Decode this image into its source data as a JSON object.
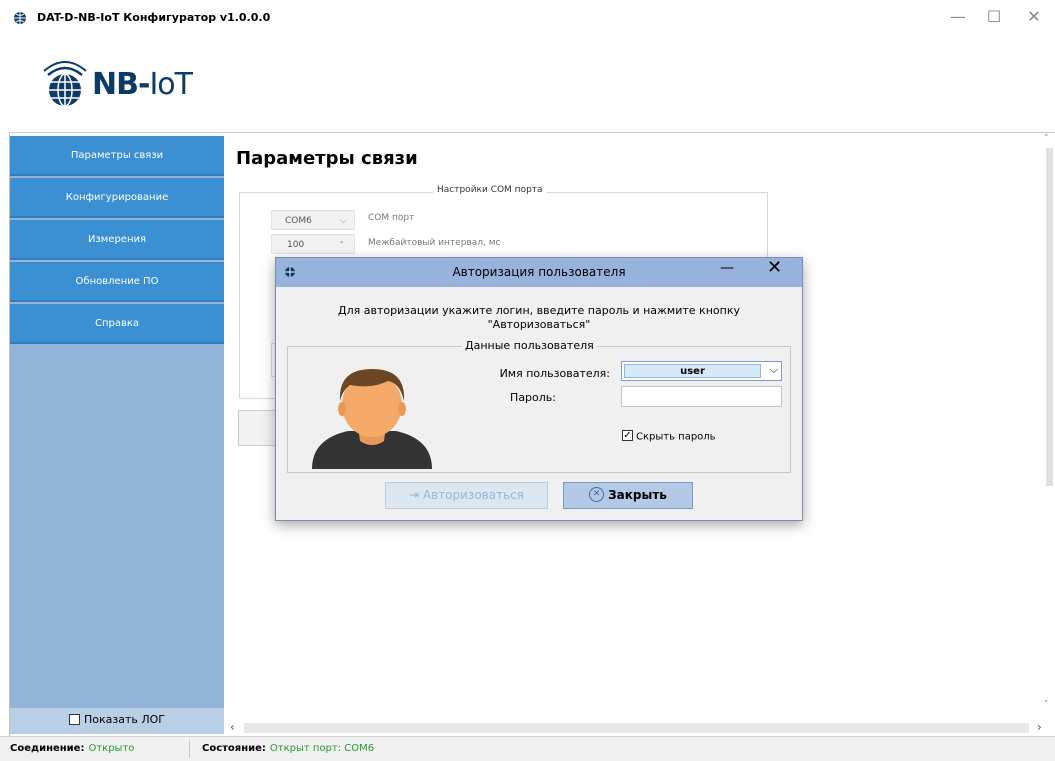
{
  "window": {
    "title": "DAT-D-NB-IoT Конфигуратор v1.0.0.0",
    "minimize": "—",
    "maximize": "☐",
    "close": "✕"
  },
  "logo": {
    "brand": "NB-",
    "brand2": "IoT"
  },
  "sidebar": {
    "items": [
      {
        "label": "Параметры связи"
      },
      {
        "label": "Конфигурирование"
      },
      {
        "label": "Измерения"
      },
      {
        "label": "Обновление ПО"
      },
      {
        "label": "Справка"
      }
    ],
    "show_log_label": "Показать ЛОГ"
  },
  "main": {
    "page_title": "Параметры связи",
    "com_group": {
      "title": "Настройки COM порта",
      "port_value": "COM6",
      "port_label": "COM порт",
      "interval_value": "100",
      "interval_label": "Межбайтовый интервал, мс"
    }
  },
  "dialog": {
    "title": "Авторизация пользователя",
    "message_line1": "Для авторизации укажите логин, введите пароль и нажмите кнопку",
    "message_line2": "\"Авторизоваться\"",
    "group_title": "Данные пользователя",
    "username_label": "Имя пользователя:",
    "username_value": "user",
    "password_label": "Пароль:",
    "hide_password_label": "Скрыть пароль",
    "auth_button": "Авторизоваться",
    "close_button": "Закрыть"
  },
  "status": {
    "connection_label": "Соединение:",
    "connection_value": "Открыто",
    "state_label": "Состояние:",
    "state_value": "Открыт порт: COM6"
  },
  "colors": {
    "nav_button": "#3b8fd3",
    "sidebar_bg": "#92b4d8",
    "dialog_title_bg": "#97b2db",
    "status_ok": "#2a9a2a",
    "logo_navy": "#0d3a66"
  }
}
